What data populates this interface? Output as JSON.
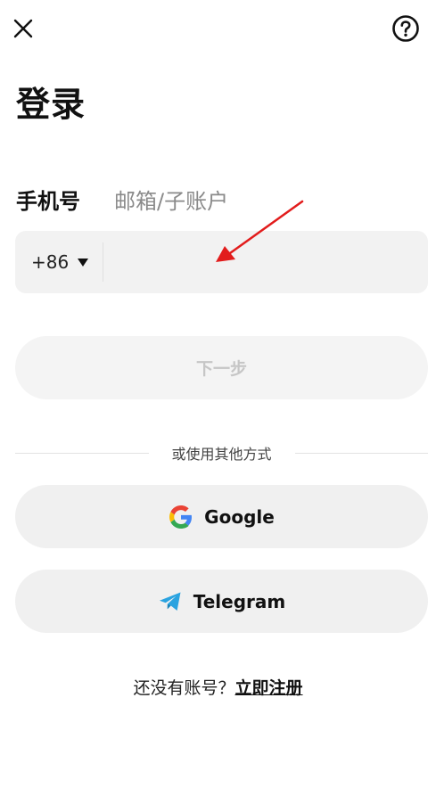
{
  "header": {
    "close_icon": "close-icon",
    "help_icon": "help-circle-icon"
  },
  "page": {
    "title": "登录"
  },
  "tabs": [
    {
      "label": "手机号",
      "active": true
    },
    {
      "label": "邮箱/子账户",
      "active": false
    }
  ],
  "phone_field": {
    "country_code": "+86",
    "value": "",
    "placeholder": ""
  },
  "next_button": {
    "label": "下一步"
  },
  "divider": {
    "label": "或使用其他方式"
  },
  "social": {
    "google_label": "Google",
    "telegram_label": "Telegram"
  },
  "register": {
    "prompt": "还没有账号？",
    "link": "立即注册"
  },
  "colors": {
    "field_bg": "#f2f2f2",
    "button_bg": "#f0f0f0",
    "disabled_text": "#c6c6c6",
    "telegram_blue": "#2aa3e0",
    "annotation_red": "#e21c1c"
  }
}
